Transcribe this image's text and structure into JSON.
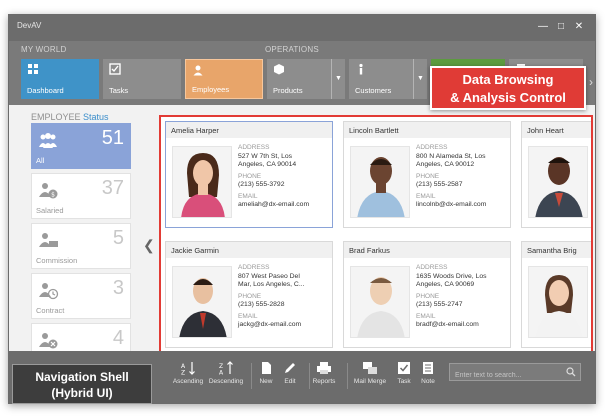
{
  "window": {
    "title": "DevAV"
  },
  "nav": {
    "group_my_world": "MY WORLD",
    "group_operations": "OPERATIONS",
    "tiles": [
      {
        "label": "Dashboard",
        "icon": "dashboard-icon"
      },
      {
        "label": "Tasks",
        "icon": "tasks-icon"
      },
      {
        "label": "Employees",
        "icon": "employees-icon"
      },
      {
        "label": "Products",
        "icon": "products-icon"
      },
      {
        "label": "Customers",
        "icon": "customers-icon"
      }
    ]
  },
  "callouts": {
    "data_browsing_line1": "Data Browsing",
    "data_browsing_line2": "& Analysis Control",
    "nav_shell_line1": "Navigation Shell",
    "nav_shell_line2": "(Hybrid UI)"
  },
  "filter": {
    "title_prefix": "EMPLOYEE",
    "title_accent": "Status",
    "items": [
      {
        "label": "All",
        "count": "51",
        "icon": "employees-group-icon"
      },
      {
        "label": "Salaried",
        "count": "37",
        "icon": "salaried-icon"
      },
      {
        "label": "Commission",
        "count": "5",
        "icon": "commission-icon"
      },
      {
        "label": "Contract",
        "count": "3",
        "icon": "contract-icon"
      },
      {
        "label": "",
        "count": "4",
        "icon": "terminated-icon"
      }
    ]
  },
  "cards": [
    {
      "name": "Amelia Harper",
      "address_label": "ADDRESS",
      "address1": "527 W 7th St, Los",
      "address2": "Angeles, CA 90014",
      "phone_label": "PHONE",
      "phone": "(213) 555-3792",
      "email_label": "EMAIL",
      "email": "ameliah@dx-email.com"
    },
    {
      "name": "Lincoln Bartlett",
      "address_label": "ADDRESS",
      "address1": "800 N Alameda St, Los",
      "address2": "Angeles, CA 90012",
      "phone_label": "PHONE",
      "phone": "(213) 555-2587",
      "email_label": "EMAIL",
      "email": "lincolnb@dx-email.com"
    },
    {
      "name": "John Heart"
    },
    {
      "name": "Jackie Garmin",
      "address_label": "ADDRESS",
      "address1": "807 West Paseo Del",
      "address2": "Mar, Los Angeles, C...",
      "phone_label": "PHONE",
      "phone": "(213) 555-2828",
      "email_label": "EMAIL",
      "email": "jackg@dx-email.com"
    },
    {
      "name": "Brad Farkus",
      "address_label": "ADDRESS",
      "address1": "1635 Woods Drive, Los",
      "address2": "Angeles, CA 90069",
      "phone_label": "PHONE",
      "phone": "(213) 555-2747",
      "email_label": "EMAIL",
      "email": "bradf@dx-email.com"
    },
    {
      "name": "Samantha Brig"
    }
  ],
  "toolbar": {
    "buttons": [
      {
        "label": "Ascending",
        "icon": "sort-ascending-icon"
      },
      {
        "label": "Descending",
        "icon": "sort-descending-icon"
      },
      {
        "label": "New",
        "icon": "new-document-icon"
      },
      {
        "label": "Edit",
        "icon": "edit-pencil-icon"
      },
      {
        "label": "Reports",
        "icon": "print-icon"
      },
      {
        "label": "Mail Merge",
        "icon": "mail-merge-icon"
      },
      {
        "label": "Task",
        "icon": "task-check-icon"
      },
      {
        "label": "Note",
        "icon": "note-icon"
      }
    ],
    "search_placeholder": "Enter text to search..."
  },
  "colors": {
    "accent_orange": "#e8a56a",
    "accent_blue": "#3f93c8",
    "callout_red": "#e03b36",
    "filter_active": "#8aa3d8"
  }
}
